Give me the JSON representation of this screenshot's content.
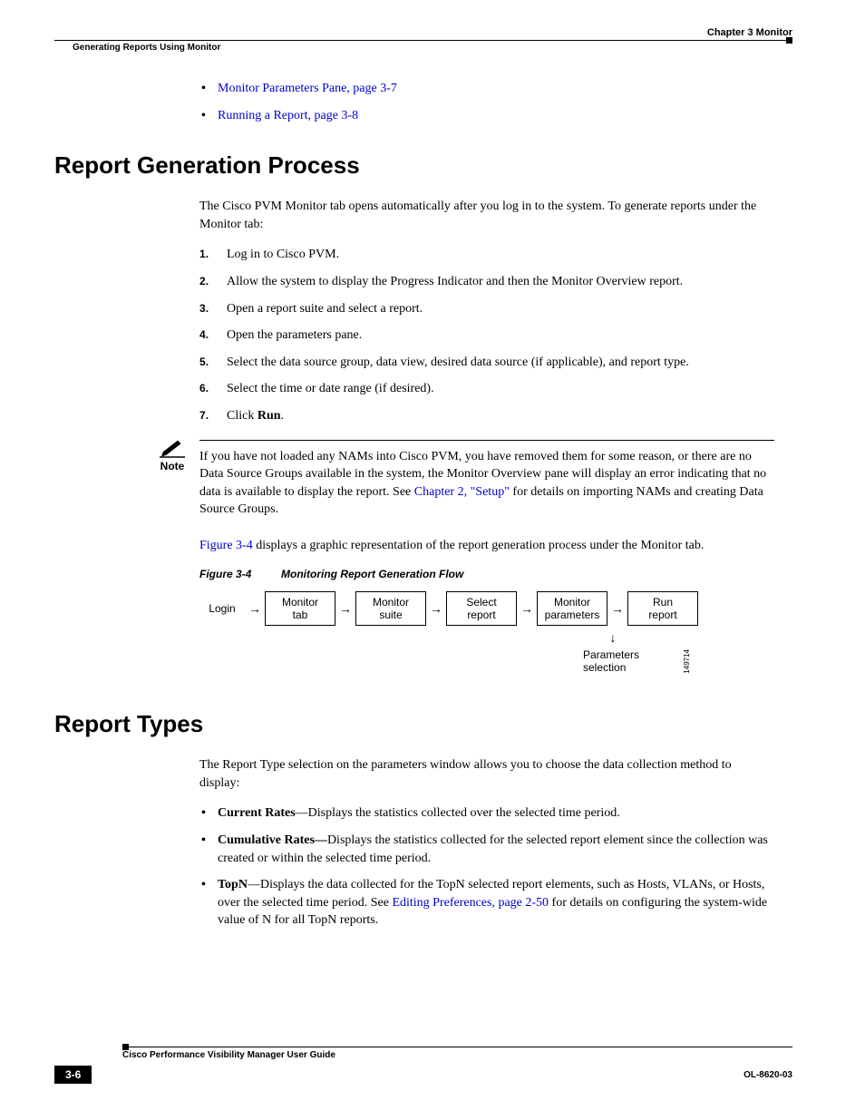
{
  "header": {
    "chapter": "Chapter 3      Monitor",
    "breadcrumb": "Generating Reports Using Monitor"
  },
  "intro_links": {
    "link1": "Monitor Parameters Pane, page 3-7",
    "link2": "Running a Report, page 3-8"
  },
  "section1": {
    "title": "Report Generation Process",
    "intro": "The Cisco PVM Monitor tab opens automatically after you log in to the system. To generate reports under the Monitor tab:",
    "steps": {
      "s1": "Log in to Cisco PVM.",
      "s2": "Allow the system to display the Progress Indicator and then the Monitor Overview report.",
      "s3": "Open a report suite and select a report.",
      "s4": "Open the parameters pane.",
      "s5": "Select the data source group, data view, desired data source (if applicable), and report type.",
      "s6": "Select the time or date range (if desired).",
      "s7_pre": "Click ",
      "s7_bold": "Run",
      "s7_post": "."
    },
    "note": {
      "label": "Note",
      "text_pre": "If you have not loaded any NAMs into Cisco PVM, you have removed them for some reason, or there are no Data Source Groups available in the system, the Monitor Overview pane will display an error indicating that no data is available to display the report. See ",
      "text_link": "Chapter 2, \"Setup\"",
      "text_post": " for details on importing NAMs and creating Data Source Groups."
    },
    "after_note_pre": "",
    "after_note_link": "Figure 3-4",
    "after_note_post": " displays a graphic representation of the report generation process under the Monitor tab.",
    "figure": {
      "num": "Figure 3-4",
      "title": "Monitoring Report Generation Flow",
      "login": "Login",
      "box1a": "Monitor",
      "box1b": "tab",
      "box2a": "Monitor",
      "box2b": "suite",
      "box3a": "Select",
      "box3b": "report",
      "box4a": "Monitor",
      "box4b": "parameters",
      "box5a": "Run",
      "box5b": "report",
      "box6a": "Parameters",
      "box6b": "selection",
      "img_id": "149714"
    }
  },
  "section2": {
    "title": "Report Types",
    "intro": "The Report Type selection on the parameters window allows you to choose the data collection method to display:",
    "b1_bold": "Current Rates",
    "b1_text": "—Displays the statistics collected over the selected time period.",
    "b2_bold": "Cumulative Rates—",
    "b2_text": "Displays the statistics collected for the selected report element since the collection was created or within the selected time period.",
    "b3_bold": "TopN",
    "b3_pre": "—Displays the data collected for the TopN selected report elements, such as Hosts, VLANs, or Hosts, over the selected time period. See ",
    "b3_link": "Editing Preferences, page 2-50",
    "b3_post": " for details on configuring the system-wide value of N for all TopN reports."
  },
  "footer": {
    "title": "Cisco Performance Visibility Manager User Guide",
    "page": "3-6",
    "doc": "OL-8620-03"
  }
}
